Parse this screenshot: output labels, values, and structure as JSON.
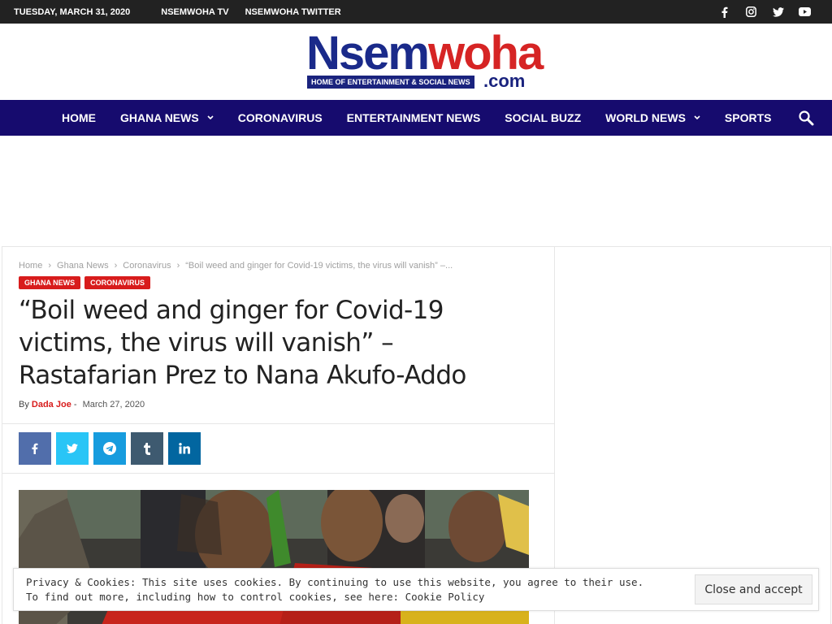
{
  "topbar": {
    "date": "TUESDAY, MARCH 31, 2020",
    "links": [
      "NSEMWOHA TV",
      "NSEMWOHA TWITTER"
    ],
    "social_icons": [
      "facebook-icon",
      "instagram-icon",
      "twitter-icon",
      "youtube-icon"
    ]
  },
  "logo": {
    "word_a": "Nsem",
    "word_b": "woha",
    "tagline": "HOME OF ENTERTAINMENT & SOCIAL NEWS",
    "dotcom": ".com"
  },
  "nav": {
    "items": [
      {
        "label": "HOME"
      },
      {
        "label": "GHANA NEWS"
      },
      {
        "label": "CORONAVIRUS"
      },
      {
        "label": "ENTERTAINMENT NEWS"
      },
      {
        "label": "SOCIAL BUZZ"
      },
      {
        "label": "WORLD NEWS"
      },
      {
        "label": "SPORTS"
      }
    ]
  },
  "breadcrumb": {
    "items": [
      "Home",
      "Ghana News",
      "Coronavirus",
      "“Boil weed and ginger for Covid-19 victims, the virus will vanish” –..."
    ]
  },
  "article": {
    "tags": [
      "GHANA NEWS",
      "CORONAVIRUS"
    ],
    "title": "“Boil weed and ginger for Covid-19 victims, the virus will vanish” – Rastafarian Prez to Nana Akufo-Addo",
    "by": "By",
    "author": "Dada Joe",
    "separator": "-",
    "date": "March 27, 2020"
  },
  "cookie": {
    "line1": "Privacy & Cookies: This site uses cookies. By continuing to use this website, you agree to their use.",
    "line2_prefix": "To find out more, including how to control cookies, see here: ",
    "link": "Cookie Policy",
    "button": "Close and accept"
  },
  "colors": {
    "topbar": "#222222",
    "nav": "#160b6e",
    "accent": "#d81c1c"
  }
}
